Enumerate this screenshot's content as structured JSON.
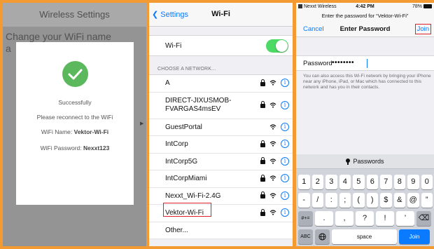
{
  "colors": {
    "background": "#f39a33",
    "accent": "#0a7aff",
    "success": "#5cb85c",
    "toggle_on": "#4cd964",
    "highlight": "#e0202a"
  },
  "panel1": {
    "header_title": "Wireless Settings",
    "background_title_line1": "Change your WiFi name",
    "background_title_line2": "a",
    "dialog": {
      "icon": "check-icon",
      "status": "Successfully",
      "message": "Please reconnect to the WiFi",
      "wifi_name_label": "WiFi Name:",
      "wifi_name_value": "Vektor-Wi-Fi",
      "wifi_password_label": "WiFi Password:",
      "wifi_password_value": "Nexxt123"
    }
  },
  "panel2": {
    "back_label": "Settings",
    "title": "Wi-Fi",
    "wifi_label": "Wi-Fi",
    "wifi_enabled": true,
    "section_header": "CHOOSE A NETWORK...",
    "networks": [
      {
        "name": "A",
        "locked": true
      },
      {
        "name": "DIRECT-JIXUSMOB-FVARGAS4msEV",
        "name_line1": "DIRECT-JIXUSMOB-",
        "name_line2": "FVARGAS4msEV",
        "locked": true
      },
      {
        "name": "GuestPortal",
        "locked": false
      },
      {
        "name": "IntCorp",
        "locked": true
      },
      {
        "name": "IntCorp5G",
        "locked": true
      },
      {
        "name": "IntCorpMiami",
        "locked": true
      },
      {
        "name": "Nexxt_Wi-Fi-2.4G",
        "locked": true
      },
      {
        "name": "Vektor-Wi-Fi",
        "locked": true,
        "highlighted": true
      }
    ],
    "other_label": "Other..."
  },
  "panel3": {
    "status_bar": {
      "carrier": "Nexxt Wireless",
      "time": "4:42 PM",
      "battery": "78%"
    },
    "prompt": "Enter the password for “Vektor-Wi-Fi”",
    "cancel_label": "Cancel",
    "title": "Enter Password",
    "join_label": "Join",
    "password_label": "Password",
    "password_value": "••••••••",
    "hint": "You can also access this Wi-Fi network by bringing your iPhone near any iPhone, iPad, or Mac which has connected to this network and has you in their contacts.",
    "keyboard": {
      "bar_label": "Passwords",
      "row1": [
        "1",
        "2",
        "3",
        "4",
        "5",
        "6",
        "7",
        "8",
        "9",
        "0"
      ],
      "row2": [
        "-",
        "/",
        ":",
        ";",
        "(",
        ")",
        "$",
        "&",
        "@",
        "”"
      ],
      "toggle_key": "#+=",
      "row3": [
        ".",
        ",",
        "?",
        "!",
        "’"
      ],
      "delete_key": "⌫",
      "abc_key": "ABC",
      "globe_key": "🌐",
      "space_key": "space",
      "join_key": "Join"
    }
  }
}
